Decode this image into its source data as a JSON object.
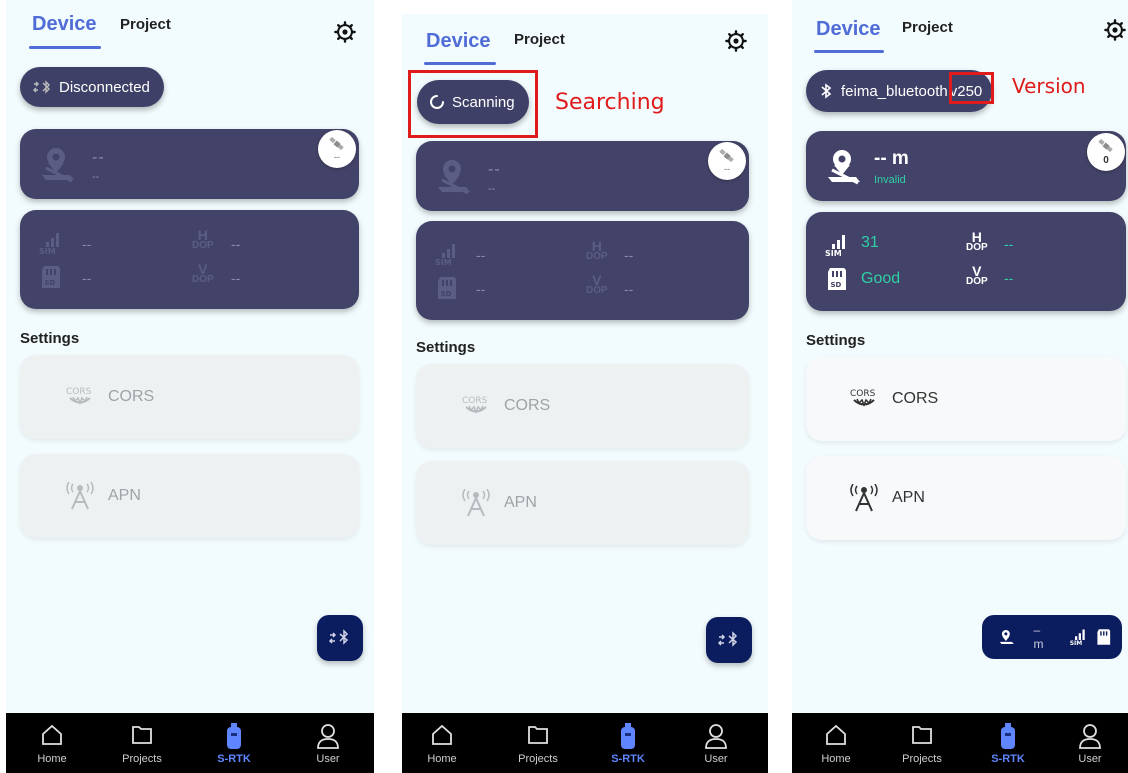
{
  "header": {
    "device_tab": "Device",
    "project_tab": "Project"
  },
  "status": {
    "disconnected": "Disconnected",
    "scanning": "Scanning",
    "connected_name": "feima_bluetooth",
    "version": "v250"
  },
  "position": {
    "placeholder_main": "--",
    "placeholder_sub": "--",
    "sat_placeholder": "--",
    "accuracy": "-- m",
    "fix_state": "Invalid",
    "sat_count": "0"
  },
  "signal": {
    "placeholder": "--",
    "sim_value": "31",
    "sd_value": "Good",
    "hdop_label_top": "H",
    "hdop_label_bottom": "DOP",
    "vdop_label_top": "V",
    "vdop_label_bottom": "DOP",
    "hdop_value": "--",
    "vdop_value": "--"
  },
  "settings": {
    "title": "Settings",
    "cors": "CORS",
    "apn": "APN",
    "cors_icon_text": "CORS"
  },
  "mini_status": {
    "accuracy": "– m"
  },
  "nav": {
    "home": "Home",
    "projects": "Projects",
    "srtk": "S-RTK",
    "user": "User"
  },
  "annotations": {
    "searching": "Searching",
    "version": "Version"
  },
  "colors": {
    "accent": "#4f6cd7",
    "card": "#434369",
    "good": "#2ed0a4",
    "fab": "#0b1d5e",
    "annotation": "#e01b1b"
  }
}
